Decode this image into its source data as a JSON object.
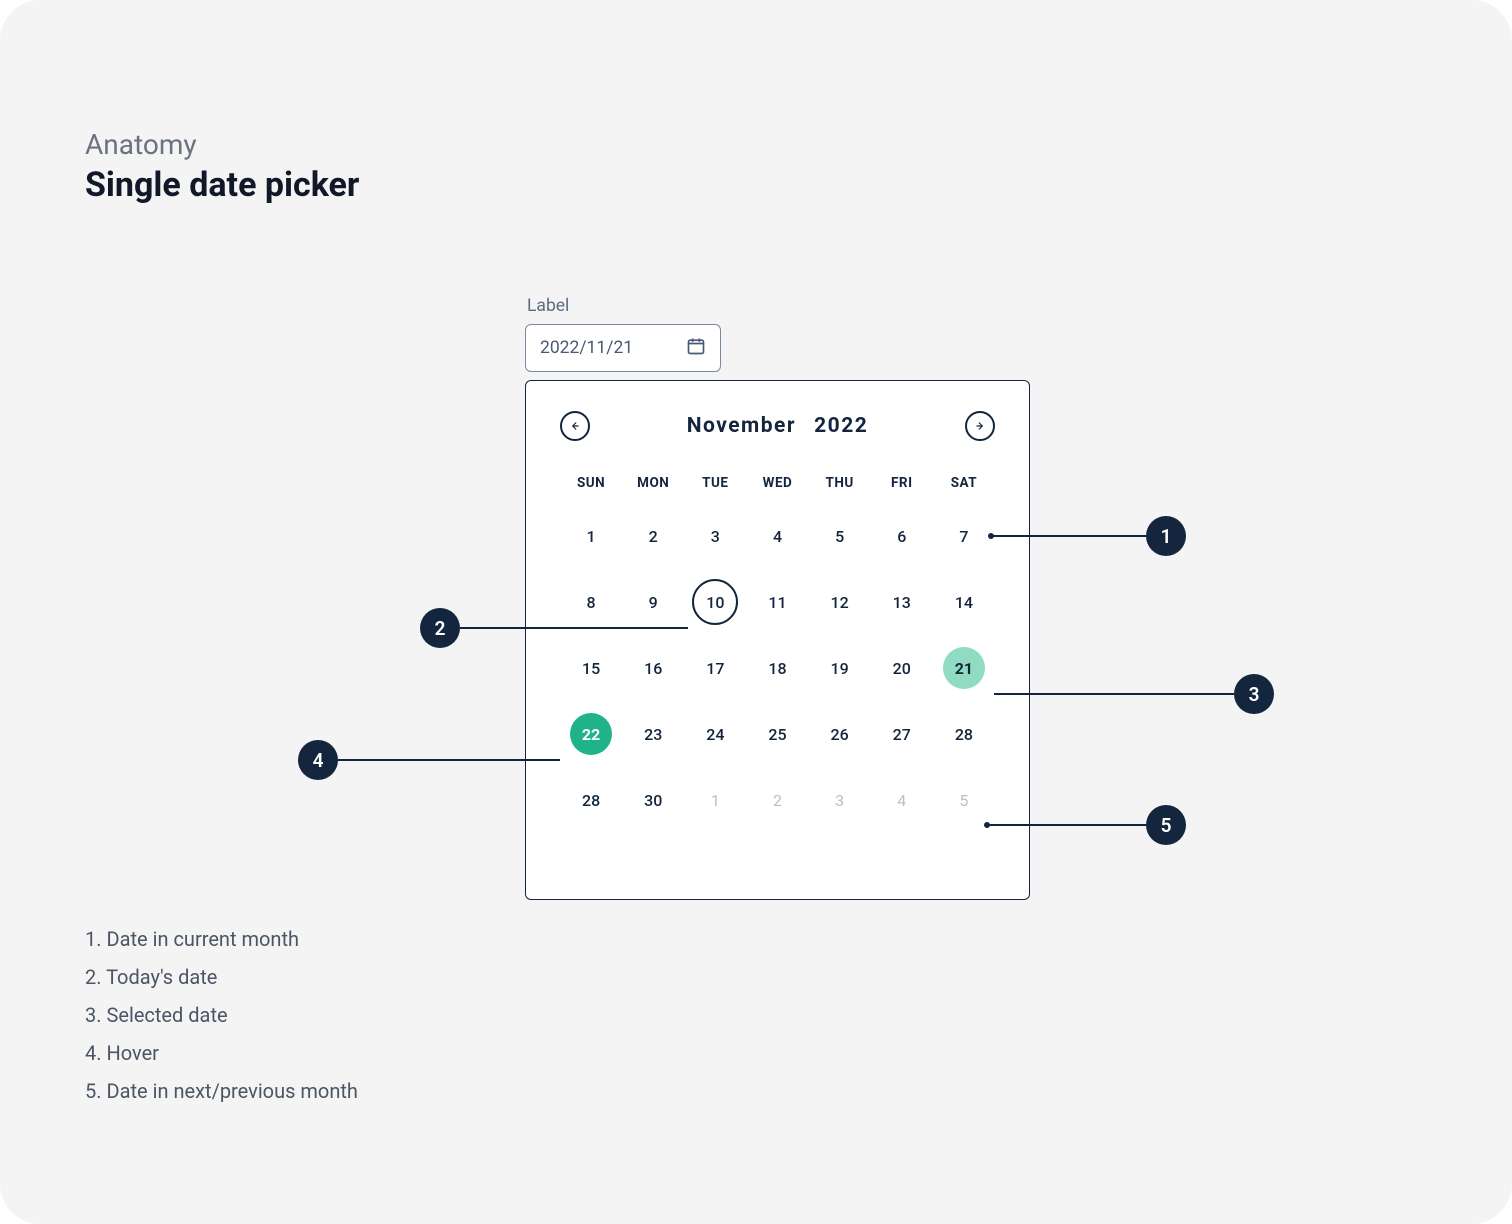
{
  "headings": {
    "eyebrow": "Anatomy",
    "title": "Single date picker"
  },
  "field": {
    "label": "Label",
    "value": "2022/11/21"
  },
  "calendar": {
    "month": "November",
    "year": "2022",
    "daysOfWeek": [
      "SUN",
      "MON",
      "TUE",
      "WED",
      "THU",
      "FRI",
      "SAT"
    ],
    "weeks": [
      [
        {
          "d": "1"
        },
        {
          "d": "2"
        },
        {
          "d": "3"
        },
        {
          "d": "4"
        },
        {
          "d": "5"
        },
        {
          "d": "6"
        },
        {
          "d": "7"
        }
      ],
      [
        {
          "d": "8"
        },
        {
          "d": "9"
        },
        {
          "d": "10",
          "state": "today"
        },
        {
          "d": "11"
        },
        {
          "d": "12"
        },
        {
          "d": "13"
        },
        {
          "d": "14"
        }
      ],
      [
        {
          "d": "15"
        },
        {
          "d": "16"
        },
        {
          "d": "17"
        },
        {
          "d": "18"
        },
        {
          "d": "19"
        },
        {
          "d": "20"
        },
        {
          "d": "21",
          "state": "selected"
        }
      ],
      [
        {
          "d": "22",
          "state": "hover"
        },
        {
          "d": "23"
        },
        {
          "d": "24"
        },
        {
          "d": "25"
        },
        {
          "d": "26"
        },
        {
          "d": "27"
        },
        {
          "d": "28"
        }
      ],
      [
        {
          "d": "28"
        },
        {
          "d": "30"
        },
        {
          "d": "1",
          "other": true
        },
        {
          "d": "2",
          "other": true
        },
        {
          "d": "3",
          "other": true
        },
        {
          "d": "4",
          "other": true
        },
        {
          "d": "5",
          "other": true
        }
      ]
    ]
  },
  "annotations": {
    "m1": "1",
    "m2": "2",
    "m3": "3",
    "m4": "4",
    "m5": "5"
  },
  "legend": {
    "l1": "1. Date in current month",
    "l2": "2. Today's date",
    "l3": "3. Selected date",
    "l4": "4. Hover",
    "l5": "5. Date in next/previous month"
  }
}
